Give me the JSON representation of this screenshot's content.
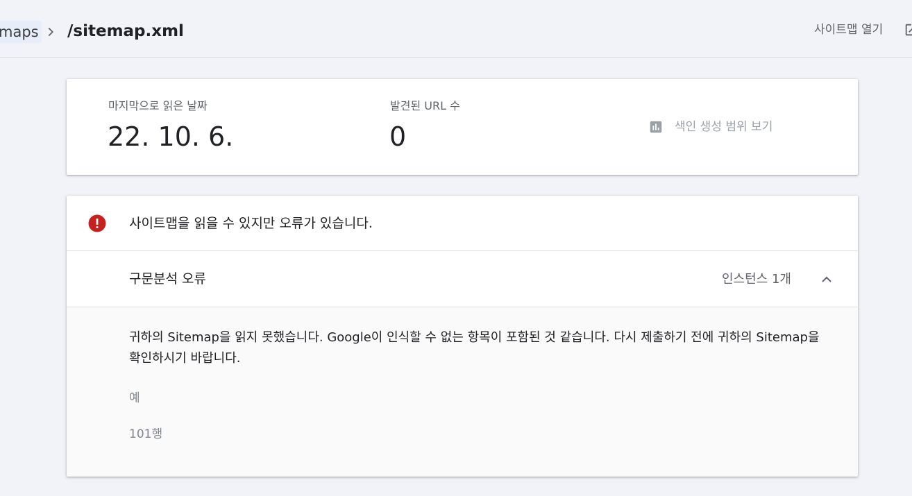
{
  "breadcrumb": {
    "previous": "maps",
    "current": "/sitemap.xml",
    "separator_icon": "chevron-right-icon"
  },
  "header": {
    "open_sitemap_label": "사이트맵 열기",
    "open_icon": "open-in-new-icon"
  },
  "stats": {
    "last_read_label": "마지막으로 읽은 날짜",
    "last_read_value": "22. 10. 6.",
    "discovered_urls_label": "발견된 URL 수",
    "discovered_urls_value": "0",
    "coverage_link_label": "색인 생성 범위 보기",
    "coverage_icon": "bar-chart-icon"
  },
  "error": {
    "icon": "error-icon",
    "color": "#c5221f",
    "title": "사이트맵을 읽을 수 있지만 오류가 있습니다.",
    "issue": {
      "type": "구문분석 오류",
      "instances": "인스턴스 1개",
      "toggle_icon": "chevron-up-icon",
      "description": "귀하의 Sitemap을 읽지 못했습니다. Google이 인식할 수 없는 항목이 포함된 것 같습니다. 다시 제출하기 전에 귀하의 Sitemap을 확인하시기 바랍니다.",
      "example_label": "예",
      "example_value": "101행"
    }
  }
}
